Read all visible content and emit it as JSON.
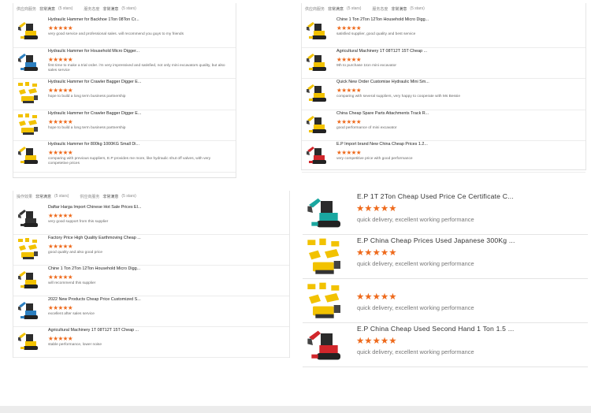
{
  "panels": [
    {
      "id": "top-left",
      "header": {
        "tab1": "供应商服务",
        "tab2": "非常满意",
        "count": "(5 stars)",
        "tab3": "服务态度",
        "tab4": "非常满意",
        "count2": "(5 stars)"
      },
      "rows": [
        {
          "title": "Hydraulic Hammer for Backhoe 1Ton 08Ton Cr...",
          "stars": "★★★★★",
          "comment": "very good service and professional sales. will recommend you guys to my friends",
          "icon": "yellow-mini-excavator"
        },
        {
          "title": "Hydraulic Hammer for Household Micro Digger...",
          "stars": "★★★★★",
          "comment": "first time to make a trial order. i'm very impressived and satisfied, not only mini excavators quality, but also sales service",
          "icon": "blue-mini-excavator"
        },
        {
          "title": "Hydraulic Hammer for Crawler Bagger Digger E...",
          "stars": "★★★★★",
          "comment": "hope to build a long term business partnership",
          "icon": "excavator-attachments"
        },
        {
          "title": "Hydraulic Hammer for Crawler Bagger Digger E...",
          "stars": "★★★★★",
          "comment": "hope to build a long term business partnership",
          "icon": "excavator-attachments"
        },
        {
          "title": "Hydraulic Hammer for 800kg 1000KG Small Di...",
          "stars": "★★★★★",
          "comment": "comparing with previous suppliers, E.P provides me more, like hydraulic shut off valves, with very competetive prices",
          "icon": "yellow-mini-excavator"
        }
      ]
    },
    {
      "id": "top-right",
      "header": {
        "tab1": "供应商服务",
        "tab2": "非常满意",
        "count": "(5 stars)",
        "tab3": "服务态度",
        "tab4": "非常满意",
        "count2": "(5 stars)"
      },
      "rows": [
        {
          "title": "Chine 1 Ton 2Ton 12Ton Household Micro Digg...",
          "stars": "★★★★★",
          "comment": "satisfied supplier, good quality and best service",
          "icon": "yellow-mini-excavator"
        },
        {
          "title": "Agricultural Machinery 1T 08T12T 15T Cheap ...",
          "stars": "★★★★★",
          "comment": "9th to purchase 1ton mini excavator",
          "icon": "yellow-mini-excavator"
        },
        {
          "title": "Quick New Order Customise Hydraulic Mini Sm...",
          "stars": "★★★★★",
          "comment": "comparing with several suppliers, very happy to cooperate with Ms Bessie",
          "icon": "yellow-mini-excavator"
        },
        {
          "title": "China Cheap Spare Parts Attachments Track R...",
          "stars": "★★★★★",
          "comment": "good performance of mini excavator",
          "icon": "yellow-mini-excavator"
        },
        {
          "title": "E.P Import brand New China Cheap Prices 1.2...",
          "stars": "★★★★★",
          "comment": "very competitive price with good performance",
          "icon": "red-mini-excavator"
        }
      ]
    },
    {
      "id": "bottom-left",
      "header": {
        "tab1": "操作效果",
        "tab2": "非常满意",
        "count": "(5 stars)",
        "tab3": "供应商服务",
        "tab4": "非常满意",
        "count2": "(5 stars)"
      },
      "rows": [
        {
          "title": "Daftar Harga Import Chinese Hot Sale Prices El...",
          "stars": "★★★★★",
          "comment": "very good support from this supplier",
          "icon": "black-mini-excavator"
        },
        {
          "title": "Factory Price High Quality Earthmoving Cheap ...",
          "stars": "★★★★★",
          "comment": "good quality and also good price",
          "icon": "excavator-attachments"
        },
        {
          "title": "Chine 1 Ton 2Ton 12Ton Household Micro Digg...",
          "stars": "★★★★★",
          "comment": "will recommend this supplier",
          "icon": "yellow-mini-excavator"
        },
        {
          "title": "2022 New Products Cheap Price Customized S...",
          "stars": "★★★★★",
          "comment": "excellent after sales service",
          "icon": "blue-mini-excavator"
        },
        {
          "title": "Agricultural Machinery 1T 08T12T 15T Cheap ...",
          "stars": "★★★★★",
          "comment": "stable performance, lower noise",
          "icon": "yellow-mini-excavator"
        }
      ]
    },
    {
      "id": "bottom-right",
      "rows": [
        {
          "title": "E.P 1T 2Ton Cheap Used Price Ce Certificate C...",
          "stars": "★★★★★",
          "comment": "quick delivery, excellent working performance",
          "icon": "teal-mini-excavator"
        },
        {
          "title": "E.P China Cheap Prices Used Japanese 300Kg ...",
          "stars": "★★★★★",
          "comment": "quick delivery, excellent working performance",
          "icon": "excavator-attachments"
        },
        {
          "title": "",
          "stars": "★★★★★",
          "comment": "quick delivery, excellent working performance",
          "icon": "excavator-attachments"
        },
        {
          "title": "E.P China Cheap Used Second Hand 1 Ton 1.5 ...",
          "stars": "★★★★★",
          "comment": "quick delivery, excellent working performance",
          "icon": "red-mini-excavator"
        }
      ]
    }
  ],
  "colors": {
    "star": "#ee6a1c",
    "yellow": "#f2c200",
    "teal": "#1aa7a0",
    "red": "#d1262b",
    "blue": "#2c7fc0"
  }
}
